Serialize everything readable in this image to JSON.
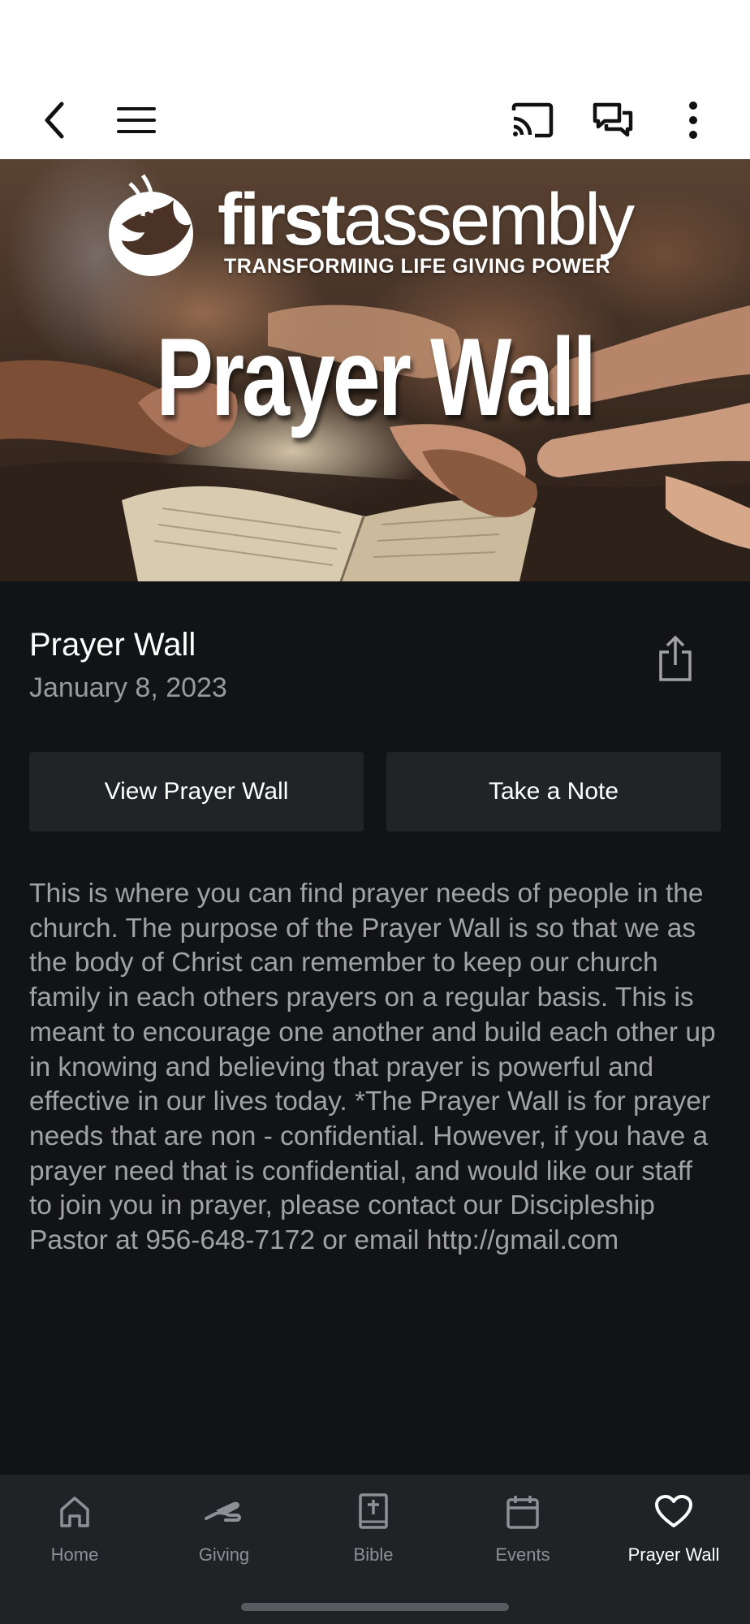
{
  "toolbar": {
    "back_icon": "back-chevron-icon",
    "menu_icon": "hamburger-menu-icon",
    "cast_icon": "cast-icon",
    "chat_icon": "chat-icon",
    "more_icon": "more-vertical-icon"
  },
  "hero": {
    "logo_bold": "first",
    "logo_light": "assembly",
    "tagline": "TRANSFORMING LIFE GIVING POWER",
    "title": "Prayer Wall"
  },
  "item": {
    "title": "Prayer Wall",
    "date": "January 8, 2023",
    "share_icon": "share-icon"
  },
  "buttons": {
    "view_label": "View Prayer Wall",
    "note_label": "Take a Note"
  },
  "description": "This is where you can find prayer needs of people in the church. The purpose of the Prayer Wall is so that we as the body of Christ can remember to keep our church family in each others prayers on a regular basis. This is meant to encourage one another and build each other up in knowing and believing that prayer is powerful and effective in our lives today. *The Prayer Wall is for prayer needs that are non - confidential. However, if you have a prayer need that is confidential, and would like our staff to join you in prayer, please contact our Discipleship Pastor at 956-648-7172 or email http://gmail.com",
  "nav": {
    "items": [
      {
        "label": "Home",
        "icon": "home-icon"
      },
      {
        "label": "Giving",
        "icon": "giving-hand-icon"
      },
      {
        "label": "Bible",
        "icon": "bible-icon"
      },
      {
        "label": "Events",
        "icon": "calendar-icon"
      },
      {
        "label": "Prayer Wall",
        "icon": "heart-icon"
      }
    ],
    "active_index": 4
  },
  "colors": {
    "background": "#121316",
    "button_bg": "#222326",
    "nav_bg": "#212226",
    "text_primary": "#ffffff",
    "text_secondary": "#a2a2a6"
  }
}
